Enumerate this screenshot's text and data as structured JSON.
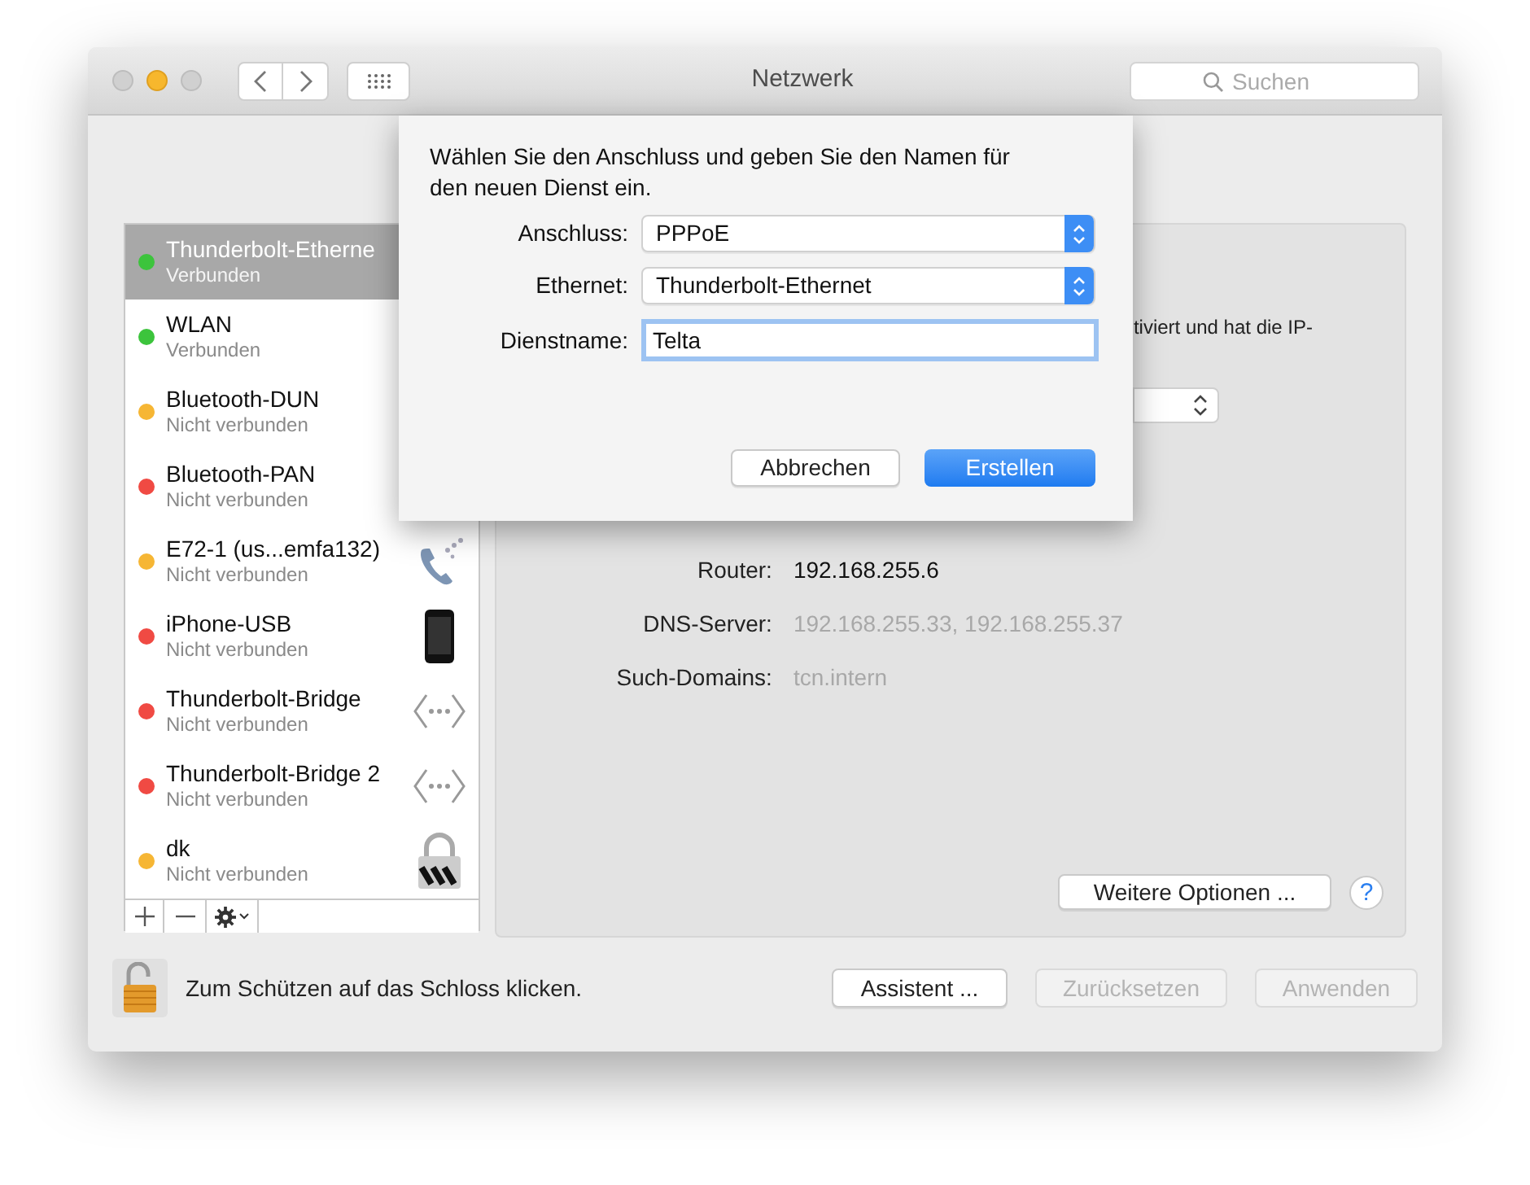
{
  "window": {
    "title": "Netzwerk",
    "search": {
      "placeholder": "Suchen"
    }
  },
  "services": [
    {
      "name": "Thunderbolt-Etherne",
      "status": "Verbunden",
      "color": "#3cc43c",
      "selected": true,
      "kind": "plain"
    },
    {
      "name": "WLAN",
      "status": "Verbunden",
      "color": "#3cc43c",
      "selected": false,
      "kind": "plain"
    },
    {
      "name": "Bluetooth-DUN",
      "status": "Nicht verbunden",
      "color": "#f6b634",
      "selected": false,
      "kind": "plain"
    },
    {
      "name": "Bluetooth-PAN",
      "status": "Nicht verbunden",
      "color": "#f04a43",
      "selected": false,
      "kind": "plain"
    },
    {
      "name": "E72-1 (us...emfa132)",
      "status": "Nicht verbunden",
      "color": "#f6b634",
      "selected": false,
      "kind": "phone"
    },
    {
      "name": "iPhone-USB",
      "status": "Nicht verbunden",
      "color": "#f04a43",
      "selected": false,
      "kind": "handset"
    },
    {
      "name": "Thunderbolt-Bridge",
      "status": "Nicht verbunden",
      "color": "#f04a43",
      "selected": false,
      "kind": "bridge"
    },
    {
      "name": "Thunderbolt-Bridge 2",
      "status": "Nicht verbunden",
      "color": "#f04a43",
      "selected": false,
      "kind": "bridge"
    },
    {
      "name": "dk",
      "status": "Nicht verbunden",
      "color": "#f6b634",
      "selected": false,
      "kind": "vpn"
    }
  ],
  "detail": {
    "status_fragment": "tiviert und hat die IP-",
    "rows": [
      {
        "label": "Router:",
        "value": "192.168.255.6",
        "dimmed": false
      },
      {
        "label": "DNS-Server:",
        "value": "192.168.255.33, 192.168.255.37",
        "dimmed": true
      },
      {
        "label": "Such-Domains:",
        "value": "tcn.intern",
        "dimmed": true
      }
    ],
    "advanced_button": "Weitere Optionen ...",
    "help": "?"
  },
  "footer": {
    "lock_text": "Zum Schützen auf das Schloss klicken.",
    "buttons": [
      {
        "label": "Assistent ...",
        "disabled": false
      },
      {
        "label": "Zurücksetzen",
        "disabled": true
      },
      {
        "label": "Anwenden",
        "disabled": true
      }
    ]
  },
  "sheet": {
    "prompt": "Wählen Sie den Anschluss und geben Sie den Namen für den neuen Dienst ein.",
    "fields": [
      {
        "kind": "popup",
        "label": "Anschluss:",
        "value": "PPPoE"
      },
      {
        "kind": "popup",
        "label": "Ethernet:",
        "value": "Thunderbolt-Ethernet"
      },
      {
        "kind": "text",
        "label": "Dienstname:",
        "value": "Telta",
        "focused": true
      }
    ],
    "buttons": [
      {
        "label": "Abbrechen",
        "default": false
      },
      {
        "label": "Erstellen",
        "default": true
      }
    ]
  }
}
